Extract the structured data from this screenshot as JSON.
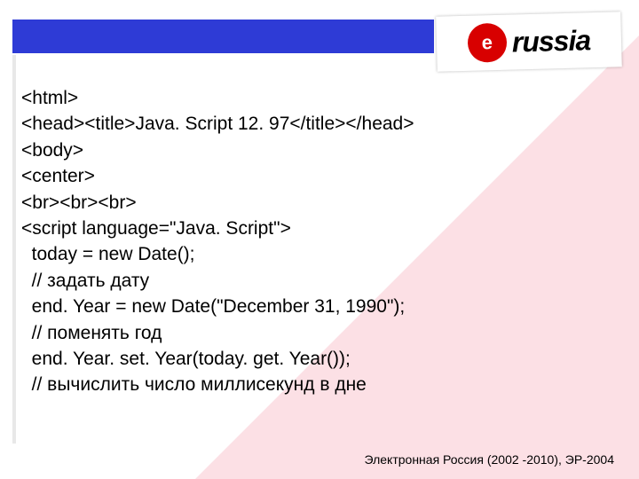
{
  "logo": {
    "badge": "e",
    "text": "russia"
  },
  "code": {
    "lines": [
      "<html>",
      "<head><title>Java. Script 12. 97</title></head>",
      "<body>",
      "<center>",
      "<br><br><br>",
      "<script language=\"Java. Script\">",
      "  today = new Date();",
      "  // задать дату",
      "  end. Year = new Date(\"December 31, 1990\");",
      "  // поменять год",
      "  end. Year. set. Year(today. get. Year());",
      "  // вычислить число миллисекунд в дне"
    ]
  },
  "footer": {
    "text": "Электронная Россия (2002 -2010), ЭР-2004"
  }
}
